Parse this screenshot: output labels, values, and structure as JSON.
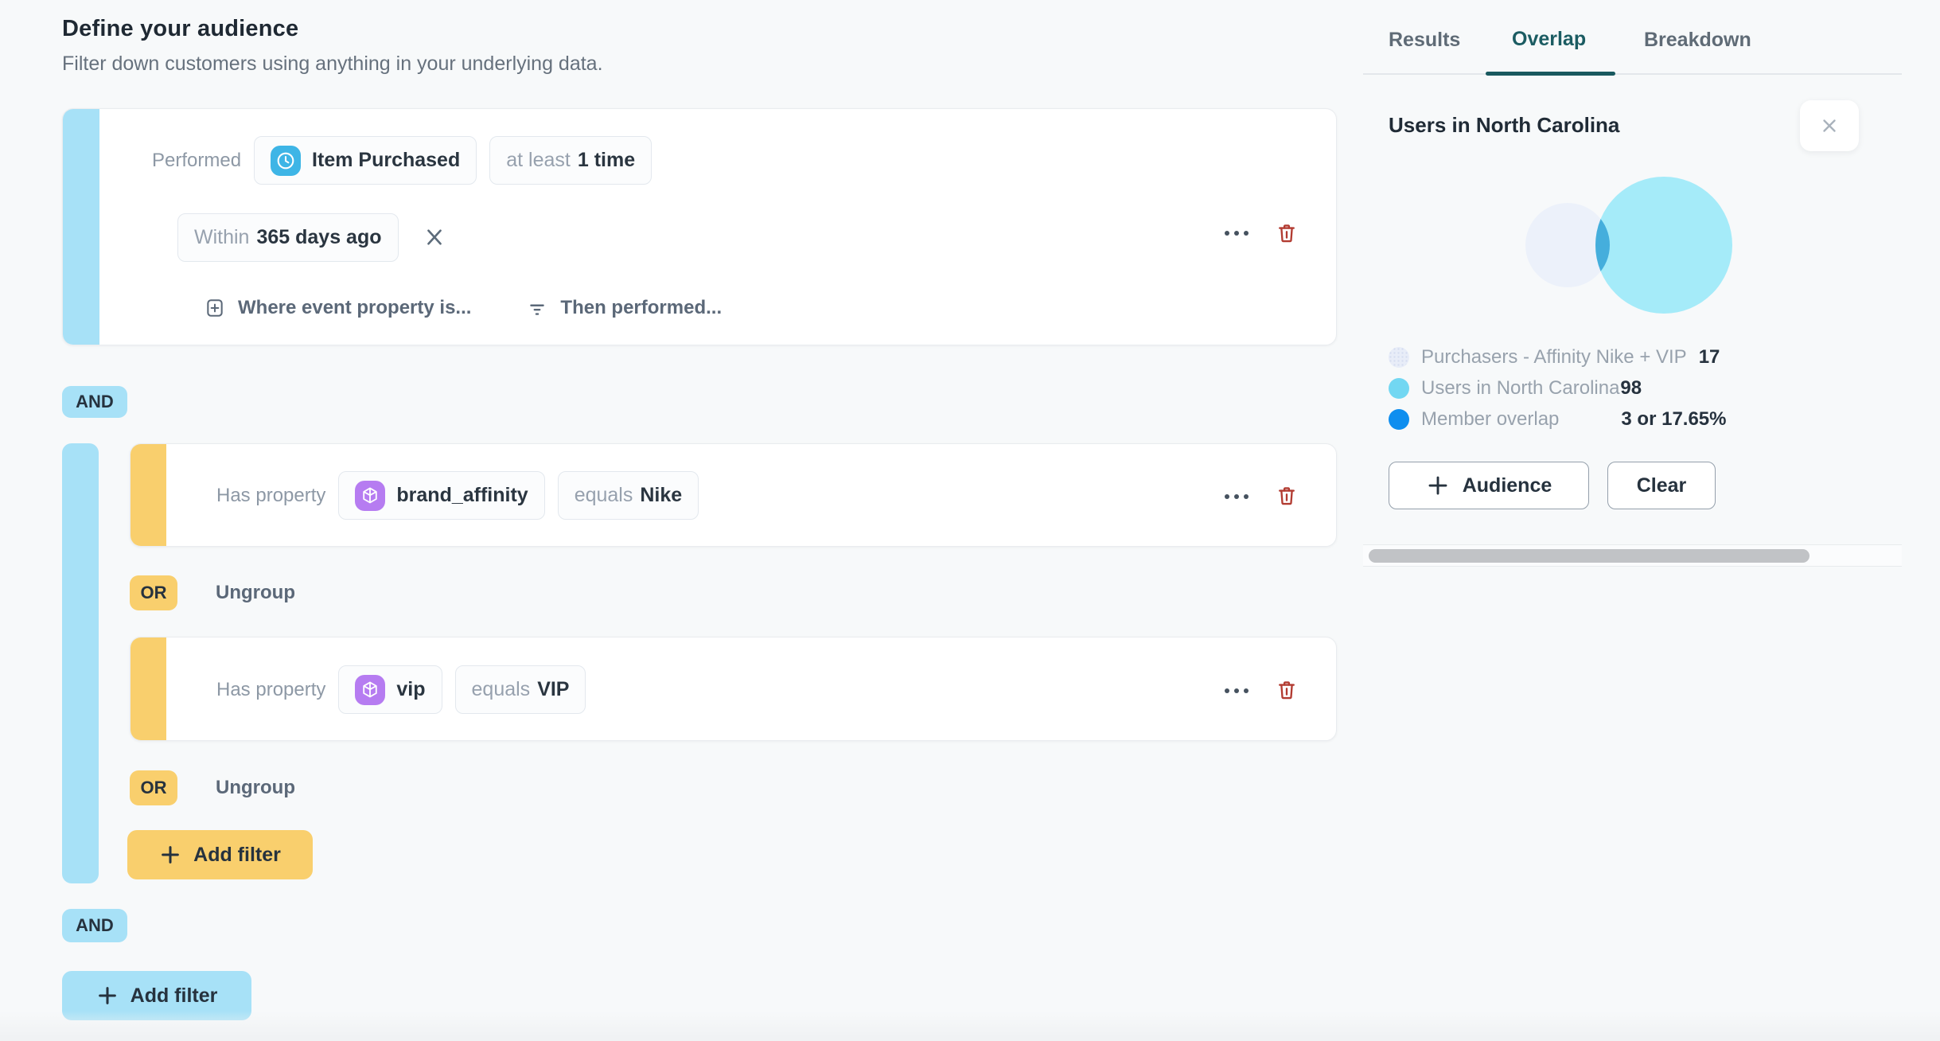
{
  "page": {
    "title": "Define your audience",
    "subtitle": "Filter down customers using anything in your underlying data."
  },
  "logic": {
    "and_label": "AND",
    "or_label": "OR",
    "ungroup_label": "Ungroup",
    "add_filter_label": "Add filter"
  },
  "event_filter": {
    "prefix": "Performed",
    "event_icon": "clock-icon",
    "event_name": "Item Purchased",
    "count_prefix": "at least",
    "count_value": "1 time",
    "window_prefix": "Within",
    "window_value": "365 days ago",
    "where_action": "Where event property is...",
    "then_action": "Then performed..."
  },
  "property_filters": {
    "rows": [
      {
        "prefix": "Has property",
        "property_icon": "cube-icon",
        "property": "brand_affinity",
        "operator_prefix": "equals",
        "value": "Nike"
      },
      {
        "prefix": "Has property",
        "property_icon": "cube-icon",
        "property": "vip",
        "operator_prefix": "equals",
        "value": "VIP"
      }
    ]
  },
  "panel": {
    "tabs": [
      {
        "label": "Results"
      },
      {
        "label": "Overlap",
        "active": true
      },
      {
        "label": "Breakdown"
      }
    ],
    "title": "Users in North Carolina",
    "venn": {
      "left_set": "Purchasers - Affinity Nike + VIP",
      "left_size": 17,
      "right_set": "Users in North Carolina",
      "right_size": 98,
      "overlap_members": 3,
      "overlap_percent": "17.65%"
    },
    "legend": [
      {
        "label": "Purchasers - Affinity Nike + VIP",
        "value": "17",
        "color": "#E8EDF8"
      },
      {
        "label": "Users in North Carolina",
        "value": "98",
        "color": "#72D7F2"
      },
      {
        "label": "Member overlap",
        "value": "3 or 17.65%",
        "color": "#0E8EEF"
      }
    ],
    "audience_button": "Audience",
    "clear_button": "Clear"
  },
  "colors": {
    "accent_blue": "#A7E1F7",
    "accent_yellow": "#F9CF6D",
    "event_icon_bg": "#3EB5E6",
    "property_icon_bg": "#B67CF1",
    "tab_active": "#1B5C62",
    "tab_underline": "#19595F",
    "danger": "#B23B31",
    "venn_left": "#ECF1FA",
    "venn_right": "#A5EBF9",
    "venn_overlap": "#45AEDC"
  }
}
